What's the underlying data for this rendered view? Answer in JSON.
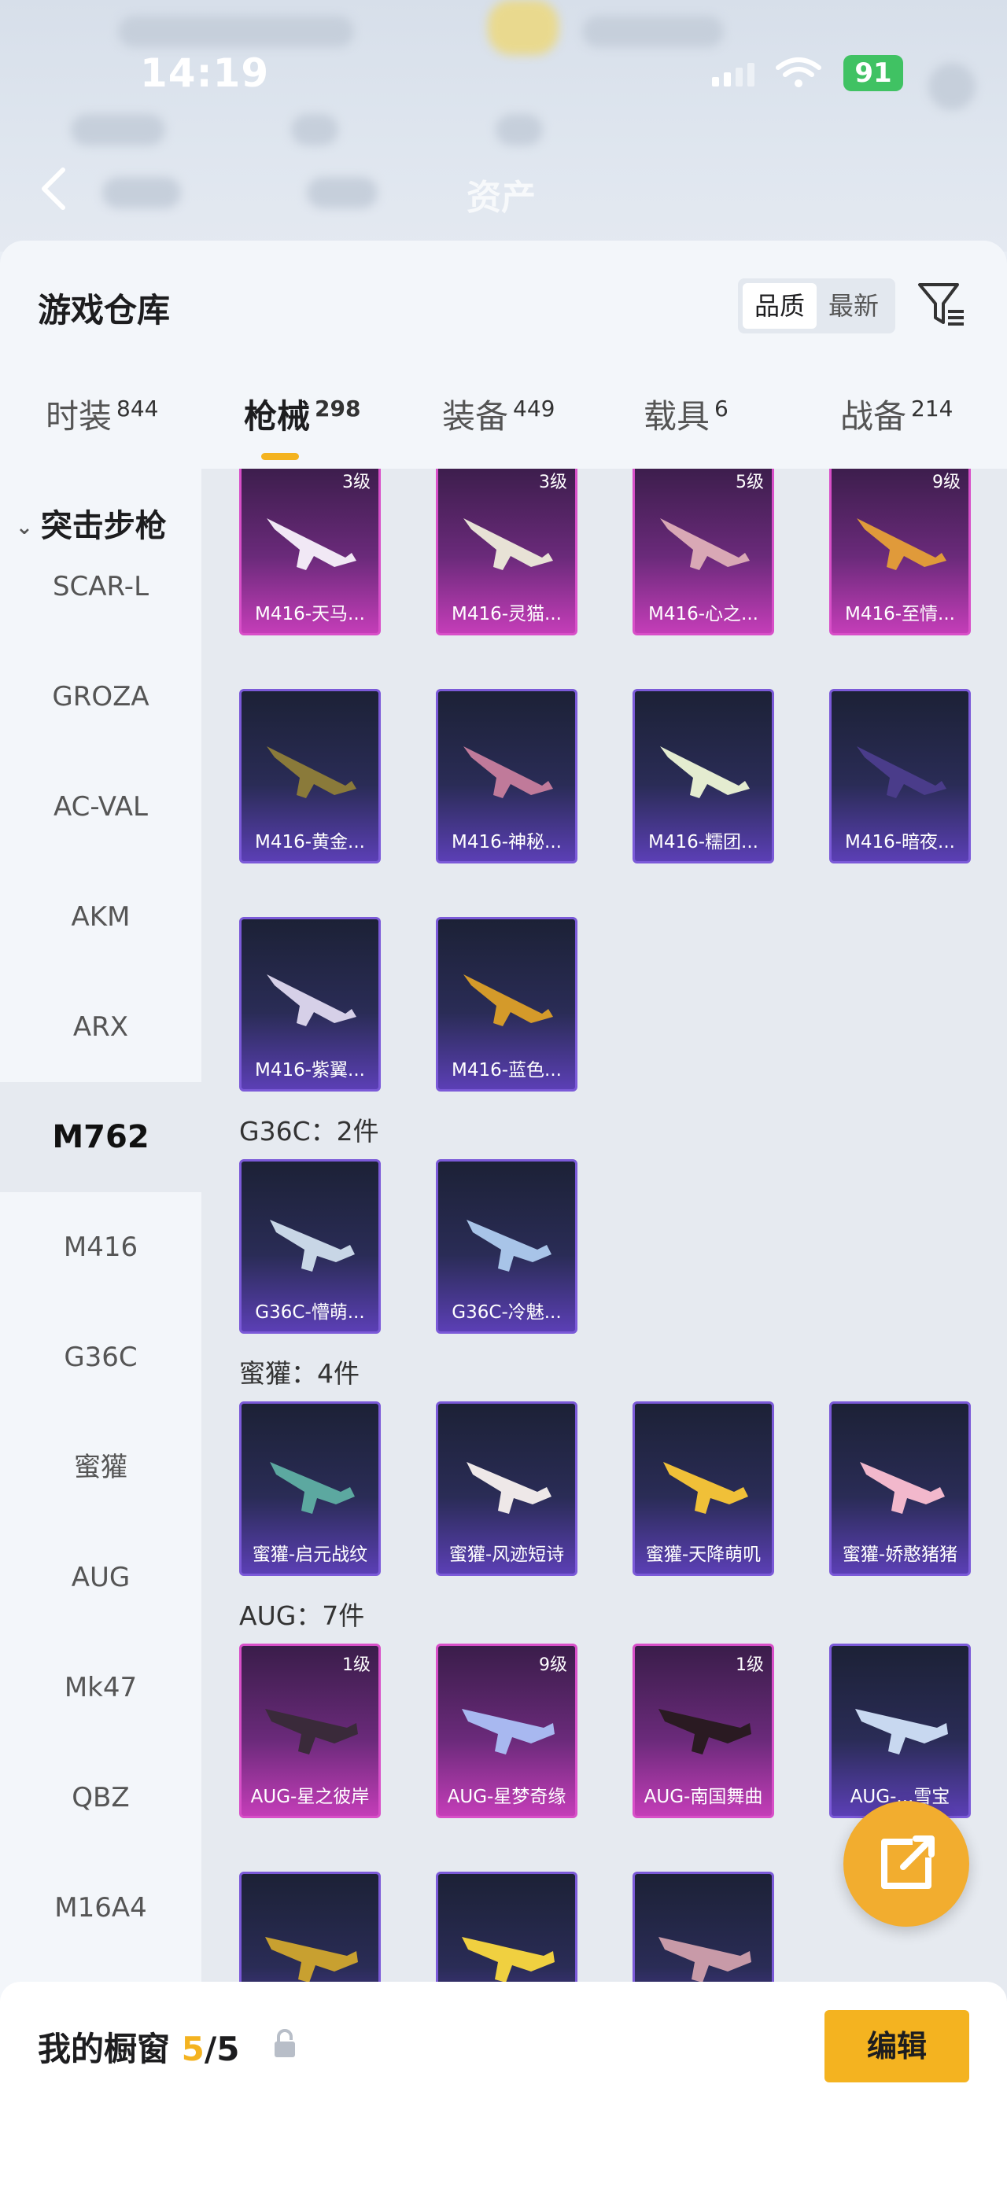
{
  "status_bar": {
    "time": "14:19",
    "battery": "91"
  },
  "header": {
    "title": "资产"
  },
  "warehouse": {
    "title": "游戏仓库",
    "sort": {
      "quality": "品质",
      "newest": "最新"
    }
  },
  "tabs": [
    {
      "label": "时装",
      "count": "844"
    },
    {
      "label": "枪械",
      "count": "298"
    },
    {
      "label": "装备",
      "count": "449"
    },
    {
      "label": "载具",
      "count": "6"
    },
    {
      "label": "战备",
      "count": "214"
    }
  ],
  "sidebar": {
    "category": "突击步枪",
    "items": [
      "SCAR-L",
      "GROZA",
      "AC-VAL",
      "AKM",
      "ARX",
      "M762",
      "M416",
      "G36C",
      "蜜獾",
      "AUG",
      "Mk47",
      "QBZ",
      "M16A4"
    ]
  },
  "grid": {
    "m416_row1": [
      {
        "name": "M416-天马...",
        "level": "3级"
      },
      {
        "name": "M416-灵猫...",
        "level": "3级"
      },
      {
        "name": "M416-心之...",
        "level": "5级"
      },
      {
        "name": "M416-至情...",
        "level": "9级"
      }
    ],
    "m416_row2": [
      {
        "name": "M416-黄金..."
      },
      {
        "name": "M416-神秘..."
      },
      {
        "name": "M416-糯团..."
      },
      {
        "name": "M416-暗夜..."
      }
    ],
    "m416_row3": [
      {
        "name": "M416-紫翼..."
      },
      {
        "name": "M416-蓝色..."
      }
    ],
    "g36c_label": "G36C：2件",
    "g36c": [
      {
        "name": "G36C-懵萌..."
      },
      {
        "name": "G36C-冷魅..."
      }
    ],
    "honey_label": "蜜獾：4件",
    "honey": [
      {
        "name": "蜜獾-启元战纹"
      },
      {
        "name": "蜜獾-风迹短诗"
      },
      {
        "name": "蜜獾-天降萌叽"
      },
      {
        "name": "蜜獾-娇憨猪猪"
      }
    ],
    "aug_label": "AUG：7件",
    "aug": [
      {
        "name": "AUG-星之彼岸",
        "level": "1级"
      },
      {
        "name": "AUG-星梦奇缘",
        "level": "9级"
      },
      {
        "name": "AUG-南国舞曲",
        "level": "1级"
      },
      {
        "name": "AUG-...雪宝"
      }
    ]
  },
  "showcase": {
    "label": "我的橱窗",
    "current": "5",
    "total": "/5",
    "edit_label": "编辑"
  },
  "colors": {
    "accent": "#f4b320",
    "rare_pink": "#d84fc8",
    "epic_purple": "#7b5ad8"
  }
}
